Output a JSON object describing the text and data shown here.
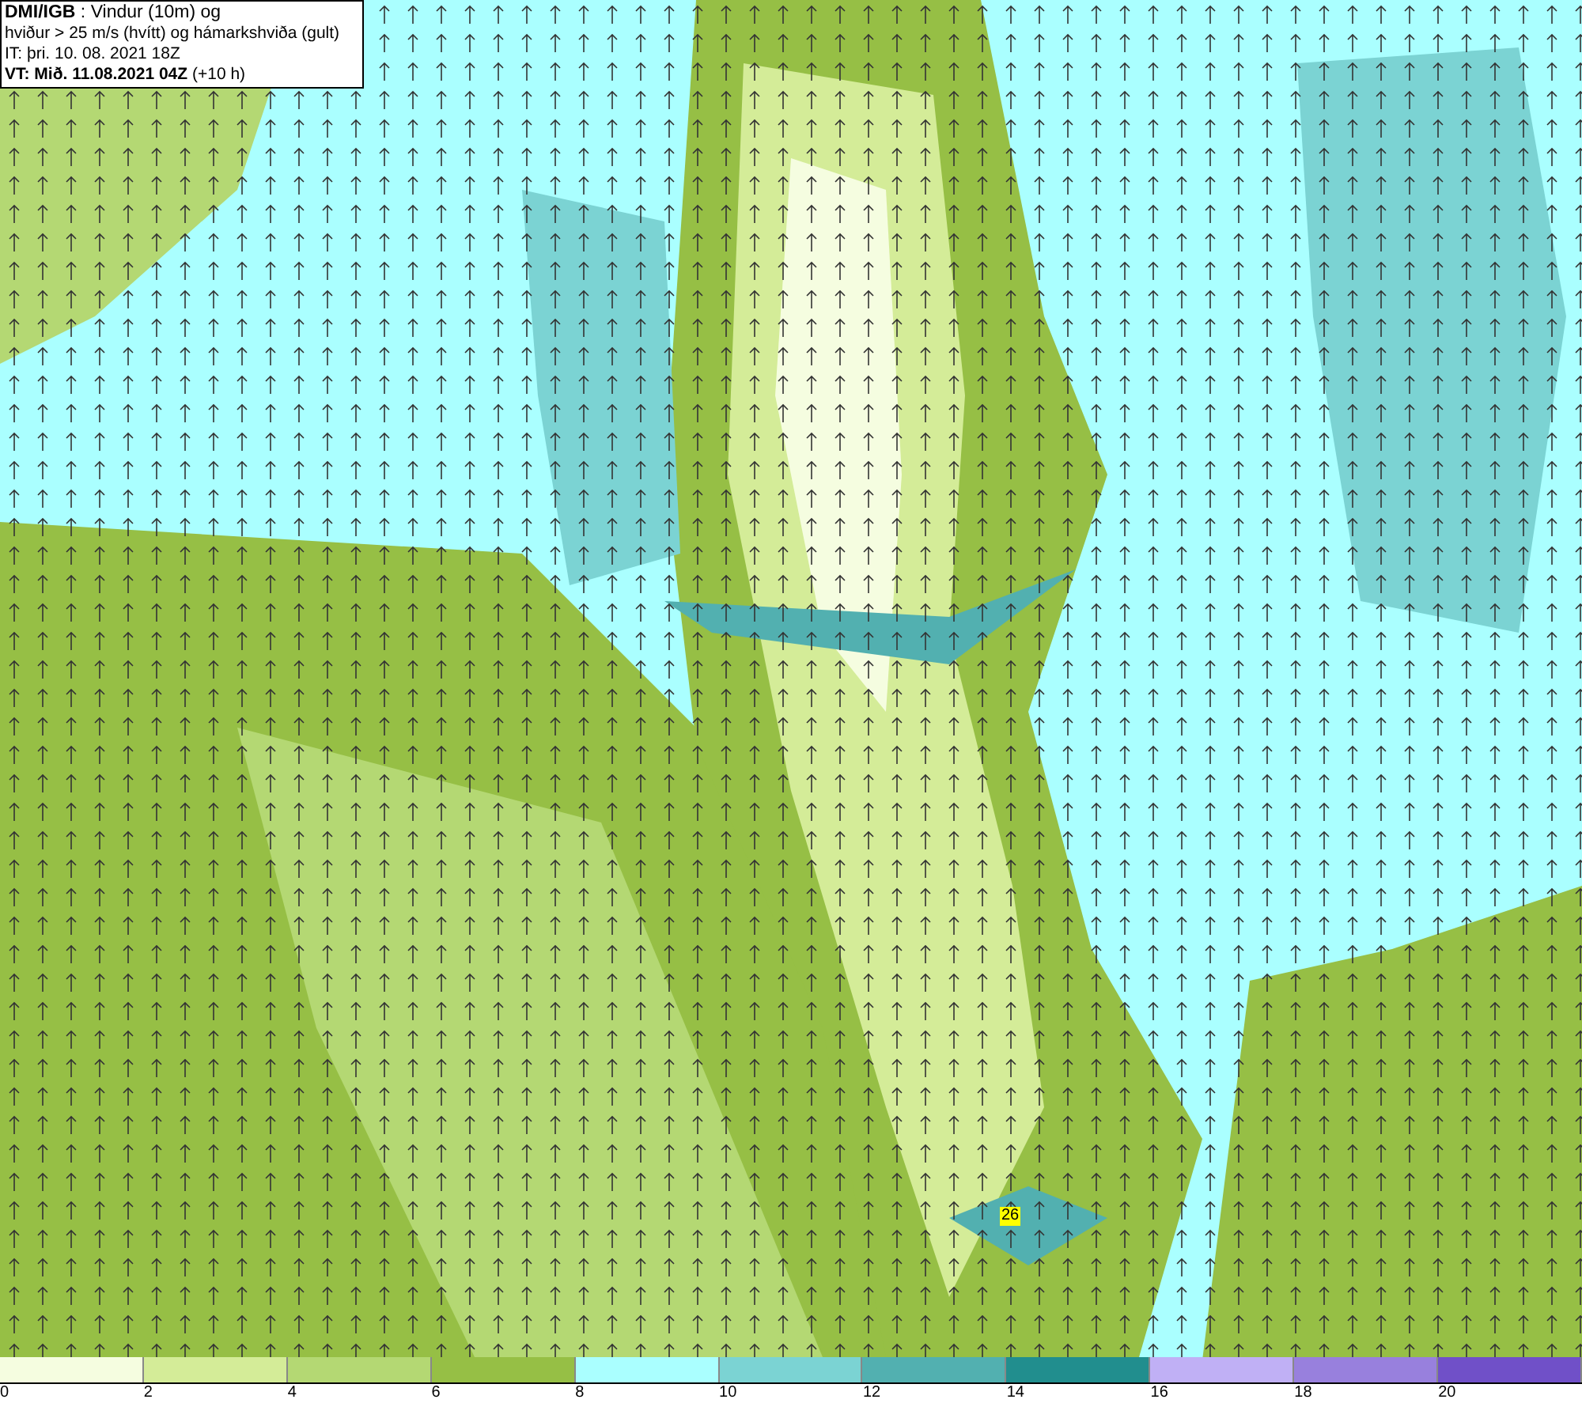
{
  "header": {
    "lines": [
      "**DMI/IGB** : Vindur (10m) og",
      "hviður > 25 m/s (hvítt) og hámarkshviða (gult)",
      "IT: þri. 10. 08. 2021 18Z",
      "**VT: Mið. 11.08.2021 04Z** (+10 h)"
    ]
  },
  "map": {
    "gust_label": "26"
  },
  "legend": {
    "bins": [
      {
        "color": "#f5fde0"
      },
      {
        "color": "#d4ec98"
      },
      {
        "color": "#b4d873"
      },
      {
        "color": "#96bf45"
      },
      {
        "color": "#aaffff"
      },
      {
        "color": "#7bd3d3"
      },
      {
        "color": "#52b0b0"
      },
      {
        "color": "#218e8e"
      },
      {
        "color": "#c0b0f5"
      },
      {
        "color": "#9880dd"
      },
      {
        "color": "#7050c8"
      }
    ],
    "ticks": [
      "0",
      "2",
      "4",
      "6",
      "8",
      "10",
      "12",
      "14",
      "16",
      "18",
      "20"
    ]
  }
}
